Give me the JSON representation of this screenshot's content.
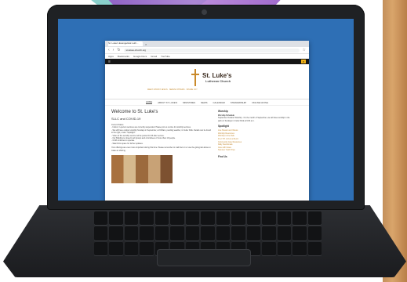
{
  "browser": {
    "tab_title": "St. Luke's Evangelical Luth...",
    "url": "st-lukes-church.org",
    "bookmarks": [
      "Apps",
      "Bookmarks",
      "Google Docs",
      "Gmail",
      "YouTube"
    ]
  },
  "site": {
    "name": "St. Luke's",
    "subtitle": "Lutheran Church",
    "tagline": "MEET CHRIST JESUS · SERVE OTHERS · SHARE JOY",
    "nav": [
      "HOME",
      "ABOUT ST. LUKE'S",
      "MINISTRIES",
      "NEWS",
      "CALENDAR",
      "STEWARDSHIP",
      "ONLINE GIVING"
    ],
    "page_title": "Welcome to St. Luke's",
    "section_title": "SLLC and COVID-19",
    "body_lines": [
      "Current Status",
      "- Indoor, in-person services are currently suspended. Please join us on-line for worship services.",
      "- We will have outdoor worship Sundays in September, at 9:00am, pending weather, in Cutler Park. Details can be found to the right, under \"Spotlight\".",
      "- Video of the worship service will be posted 10:15 after service.",
      "- Our Building is closed to all groups and committees of more than 10 people.",
      "- CCM continues to operate.",
      "- Watch this space for further updates.",
      "Your offerings are even more important during this time. Please remember to mail them in or use the giving tab above to make an offering."
    ],
    "sidebar": {
      "worship_heading": "Worship",
      "worship_schedule_label": "Worship Schedule",
      "worship_schedule_text": "September Outdoor Worship - On the month of September, we will have worship in the park on Sundays in Cutler Park at 9:00 a.m.",
      "spotlight_heading": "Spotlight",
      "spotlight_links": [
        "Live Stream and Videos",
        "Worship Resources",
        "Worship in the Park",
        "F.A.I.T.H. & Fun at SLLC",
        "Community Care Resources",
        "Daily Devotionals",
        "Give with Grace",
        "Summer Youth Trips"
      ],
      "find_us_heading": "Find Us"
    }
  },
  "colors": {
    "accent": "#c48a30",
    "brand_dark": "#3a2a1e",
    "screen_bg": "#2e6fb5"
  }
}
